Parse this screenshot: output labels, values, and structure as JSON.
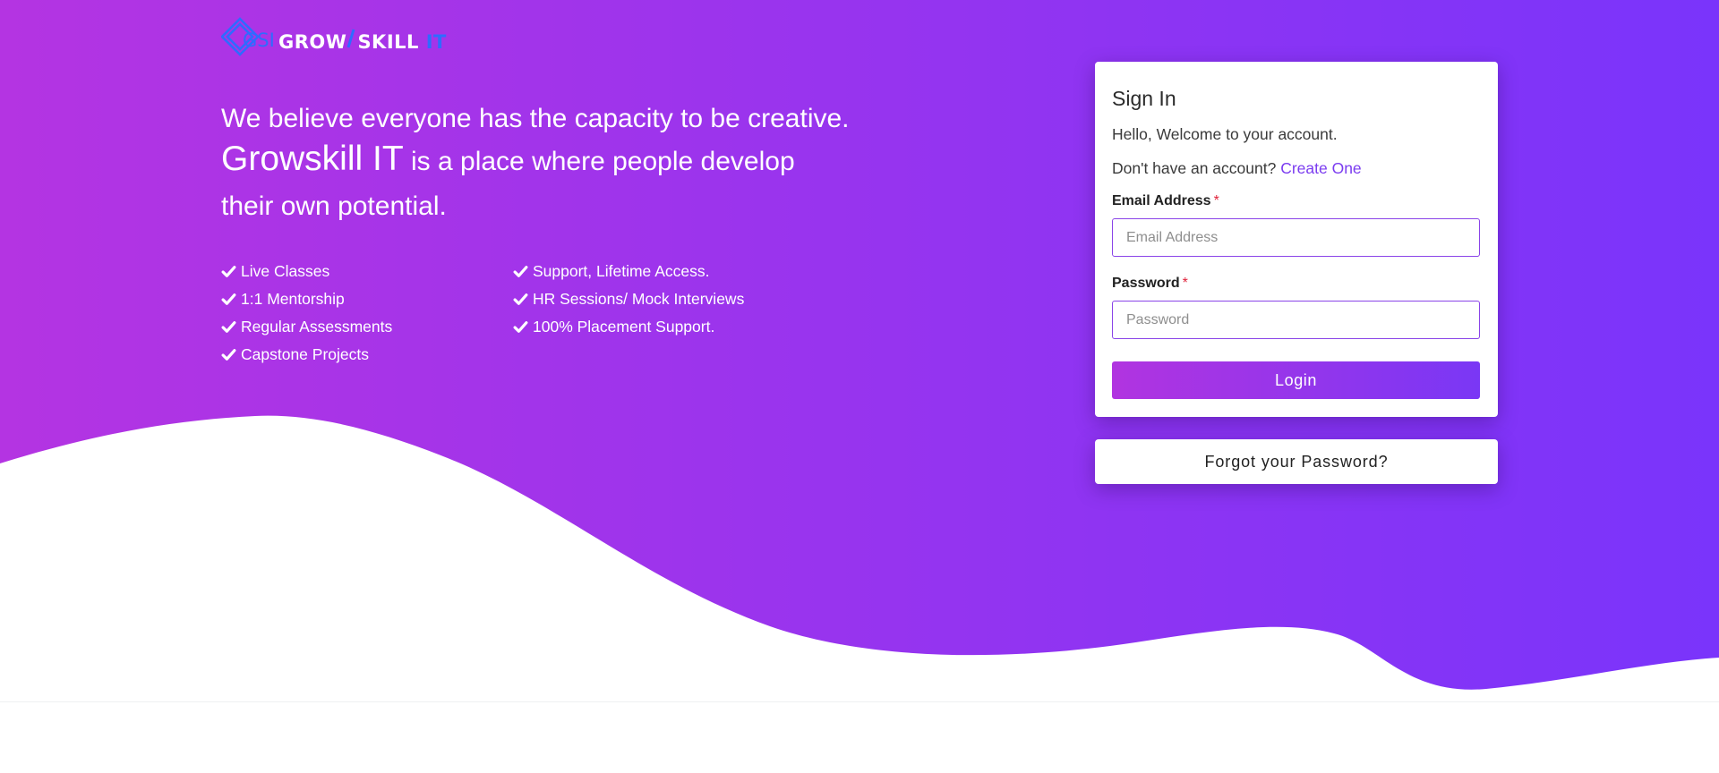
{
  "brand": {
    "logo_mark_text": "GSI",
    "name_grow": "GROW",
    "name_skill": "SKILL",
    "name_it": "IT"
  },
  "hero": {
    "line1": "We believe everyone has the capacity to be creative.",
    "brand": "Growskill IT",
    "line2_rest": " is a place where people develop",
    "line3": "their own potential."
  },
  "features": {
    "left": [
      "Live Classes",
      "1:1 Mentorship",
      "Regular Assessments",
      "Capstone Projects"
    ],
    "right": [
      "Support, Lifetime Access.",
      "HR Sessions/ Mock Interviews",
      "100% Placement Support."
    ]
  },
  "signin": {
    "title": "Sign In",
    "greeting": "Hello, Welcome to your account.",
    "no_account_text": "Don't have an account? ",
    "create_link": "Create One",
    "email_label": "Email Address",
    "email_placeholder": "Email Address",
    "email_value": "",
    "password_label": "Password",
    "password_placeholder": "Password",
    "password_value": "",
    "required_marker": "*",
    "login_label": "Login",
    "forgot_label": "Forgot your Password?"
  },
  "colors": {
    "gradient_start": "#b134e0",
    "gradient_end": "#7b35fa",
    "link": "#7b3cf0",
    "logo_accent": "#2f6bff",
    "required": "#e0223a"
  },
  "icons": {
    "logo": "gsi-diamond-logo-icon",
    "feature_bullet": "check-icon"
  }
}
